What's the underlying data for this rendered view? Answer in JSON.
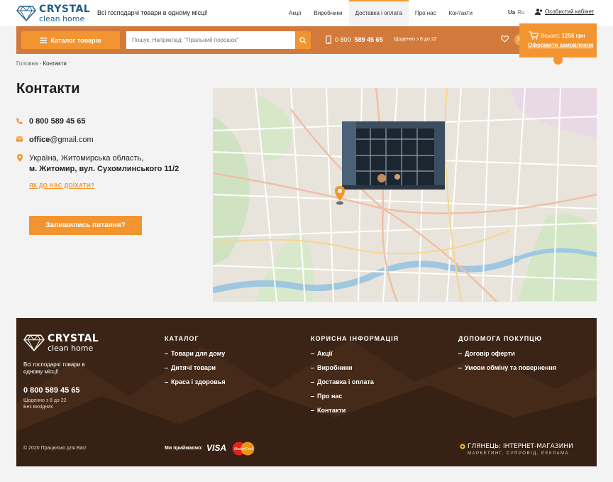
{
  "header": {
    "logo_line1": "CRYSTAL",
    "logo_line2": "clean home",
    "tagline": "Всі господарчі товари в одному місці!",
    "nav": [
      "Акції",
      "Виробники",
      "Доставка і оплата",
      "Про нас",
      "Контакти"
    ],
    "lang_active": "Ua",
    "lang_other": "Ru",
    "cabinet": "Особистий кабінет"
  },
  "toolbar": {
    "catalog_label": "Каталог товарів",
    "search_placeholder": "Пошук, Наприклад: \"Пральний порошок\"",
    "phone_prefix": "0 800",
    "phone_main": "589 45 65",
    "hours": "Щоденно з 8 до 22",
    "wishlist_count": "10",
    "cart_label": "Всього:",
    "cart_total": "1256 грн",
    "order_label": "Оформити замовлення"
  },
  "breadcrumb": {
    "home": "Головна",
    "sep": " - ",
    "current": "Контакти"
  },
  "page": {
    "title": "Контакти",
    "phone": "0 800 589 45 65",
    "email_user": "office",
    "email_domain": "@gmail.com",
    "address_line1": "Україна, Житомирська область,",
    "address_line2": "м. Житомир, вул. Сухомлинського 11/2",
    "directions": "ЯК ДО НАС ДОЇХАТИ?",
    "question_button": "Залишились питання?"
  },
  "footer": {
    "logo_line1": "CRYSTAL",
    "logo_line2": "clean home",
    "tagline": "Всі господарчі товари в одному місці!",
    "phone": "0 800 589 45 65",
    "hours_line1": "Щоденно з 8 до 22",
    "hours_line2": "Без вихідних",
    "copyright": "© 2020 Працюємо для Вас!",
    "columns": [
      {
        "title": "КАТАЛОГ",
        "links": [
          "Товари для дому",
          "Дитячі товари",
          "Краса і здоровья"
        ]
      },
      {
        "title": "КОРИСНА ІНФОРМАЦІЯ",
        "links": [
          "Акції",
          "Виробники",
          "Доставка і оплата",
          "Про нас",
          "Контакти"
        ]
      },
      {
        "title": "ДОПОМОГА ПОКУПЦЮ",
        "links": [
          "Договір оферти",
          "Умови обміну та повернення"
        ]
      }
    ],
    "accept_label": "Ми приймаємо:",
    "visa": "VISA",
    "mastercard": "MasterCard",
    "agency_name": "ГЛЯНЕЦЬ: ІНТЕРНЕТ-МАГАЗИНИ",
    "agency_tag": "МАРКЕТИНГ, СУПРОВІД, РЕКЛАМА"
  },
  "colors": {
    "accent": "#f29530",
    "bar": "#d27a3c",
    "brand": "#1f5e88",
    "footer": "#3b2416"
  }
}
